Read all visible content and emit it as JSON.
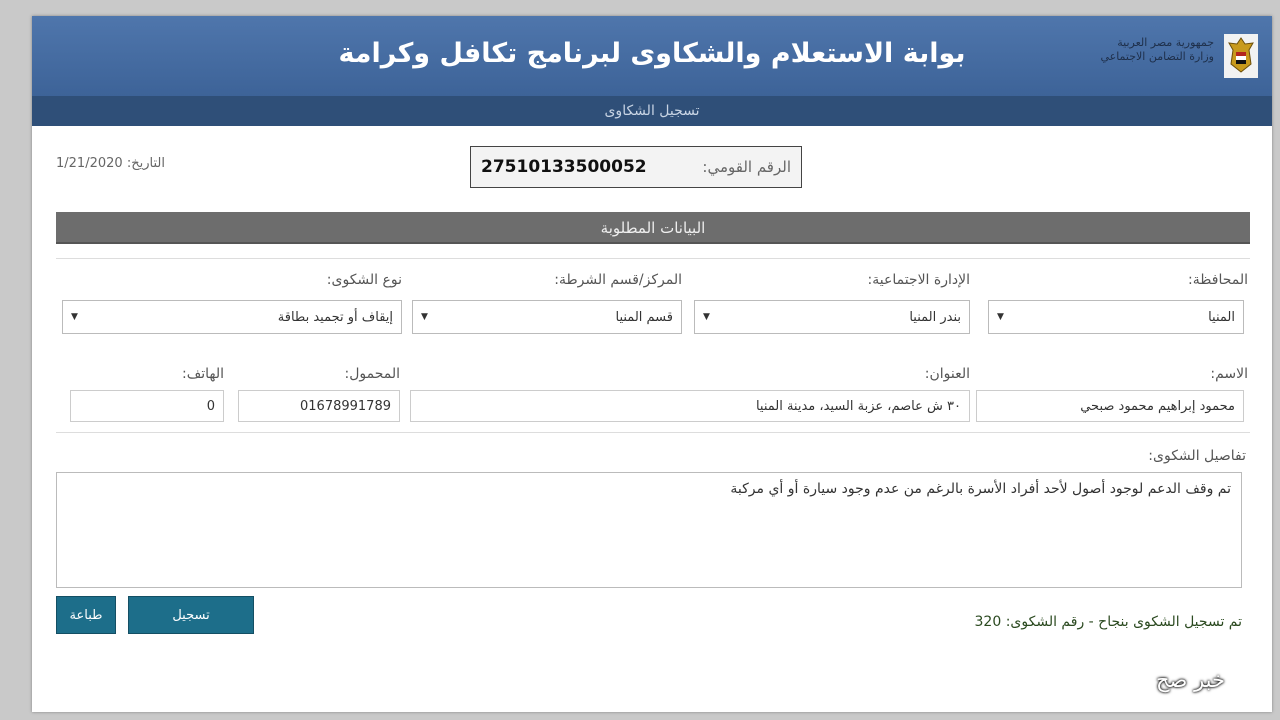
{
  "header": {
    "title": "بوابة الاستعلام والشكاوى لبرنامج تكافل وكرامة",
    "ministry_line1": "جمهورية مصر العربية",
    "ministry_line2": "وزارة التضامن الاجتماعي",
    "subtitle": "تسجيل الشكاوى"
  },
  "meta": {
    "date_label": "التاريخ:",
    "date_value": "1/21/2020",
    "national_id_label": "الرقم القومي:",
    "national_id_value": "27510133500052"
  },
  "section": {
    "title": "البيانات المطلوبة"
  },
  "form": {
    "governorate": {
      "label": "المحافظة:",
      "value": "المنيا"
    },
    "social_admin": {
      "label": "الإدارة الاجتماعية:",
      "value": "بندر المنيا"
    },
    "police_center": {
      "label": "المركز/قسم الشرطة:",
      "value": "قسم المنيا"
    },
    "complaint_type": {
      "label": "نوع الشكوى:",
      "value": "إيقاف أو تجميد بطاقة"
    },
    "name": {
      "label": "الاسم:",
      "value": "محمود إبراهيم محمود صبحي"
    },
    "address": {
      "label": "العنوان:",
      "value": "٣٠ ش عاصم، عزبة السيد، مدينة المنيا"
    },
    "mobile": {
      "label": "المحمول:",
      "value": "01678991789"
    },
    "phone": {
      "label": "الهاتف:",
      "value": "0"
    },
    "details": {
      "label": "تفاصيل الشكوى:",
      "value": "تم وقف الدعم لوجود أصول لأحد أفراد الأسرة بالرغم من عدم وجود سيارة أو أي مركبة"
    }
  },
  "actions": {
    "submit_label": "تسجيل",
    "print_label": "طباعة"
  },
  "status": {
    "message": "تم تسجيل الشكوى بنجاح - رقم الشكوى: 320"
  },
  "watermark": "خبر صح",
  "colors": {
    "header": "#4f76ac",
    "subheader": "#2f4f78",
    "section_bar": "#6d6d6d",
    "button": "#1d6e8a"
  }
}
